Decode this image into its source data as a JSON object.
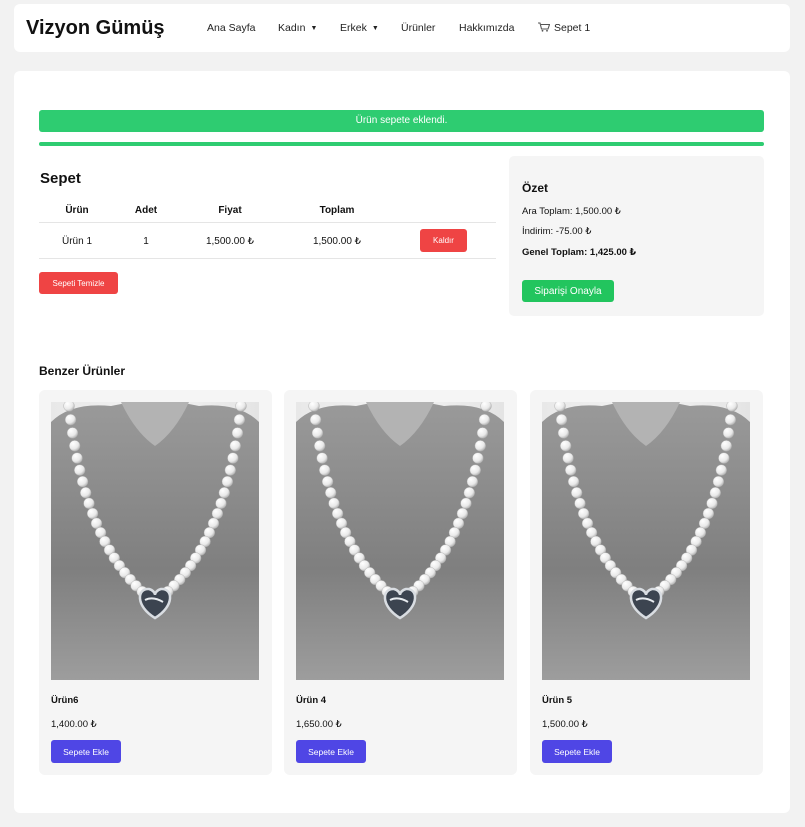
{
  "brand": "Vizyon Gümüş",
  "nav": {
    "items": [
      {
        "label": "Ana Sayfa"
      },
      {
        "label": "Kadın",
        "caret": "▼"
      },
      {
        "label": "Erkek",
        "caret": "▼"
      },
      {
        "label": "Ürünler"
      },
      {
        "label": "Hakkımızda"
      },
      {
        "label": "Sepet 1",
        "icon": "cart-icon"
      }
    ]
  },
  "alert": {
    "message": "Ürün sepete eklendi.",
    "color": "#2ecc71"
  },
  "cart": {
    "title": "Sepet",
    "columns": [
      "Ürün",
      "Adet",
      "Fiyat",
      "Toplam"
    ],
    "rows": [
      {
        "product": "Ürün 1",
        "quantity": "1",
        "price": "1,500.00 ₺",
        "total": "1,500.00 ₺",
        "remove_label": "Kaldır"
      }
    ],
    "clear_label": "Sepeti Temizle"
  },
  "summary": {
    "title": "Özet",
    "subtotal": "Ara Toplam: 1,500.00 ₺",
    "discount": "İndirim: -75.00 ₺",
    "grand_total": "Genel Toplam: 1,425.00 ₺",
    "confirm_label": "Siparişi Onayla"
  },
  "similar": {
    "title": "Benzer Ürünler",
    "products": [
      {
        "name": "Ürün6",
        "price": "1,400.00 ₺",
        "button": "Sepete Ekle",
        "image": "pearl-necklace"
      },
      {
        "name": "Ürün 4",
        "price": "1,650.00 ₺",
        "button": "Sepete Ekle",
        "image": "pearl-necklace"
      },
      {
        "name": "Ürün 5",
        "price": "1,500.00 ₺",
        "button": "Sepete Ekle",
        "image": "pearl-necklace"
      }
    ]
  },
  "colors": {
    "success": "#2ecc71",
    "danger": "#ef4444",
    "primary": "#4f46e5",
    "confirm": "#22c55e"
  }
}
